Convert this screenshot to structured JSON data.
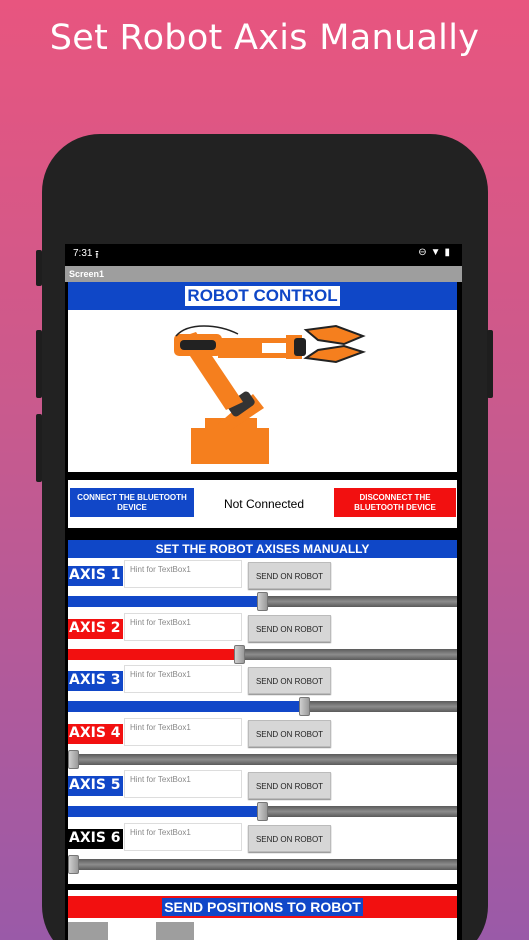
{
  "promo": {
    "title": "Set Robot Axis Manually"
  },
  "status_bar": {
    "time": "7:31",
    "upload_icon": "upload-arrow",
    "icons": [
      "do-not-disturb-icon",
      "wifi-icon",
      "battery-icon"
    ]
  },
  "app": {
    "screen_title": "Screen1",
    "header": "ROBOT CONTROL",
    "connect_button": "CONNECT THE BLUETOOTH DEVICE",
    "connection_status": "Not Connected",
    "disconnect_button": "DISCONNECT THE BLUETOOTH DEVICE",
    "axes_header": "SET THE ROBOT AXISES MANUALLY",
    "send_positions_header": "SEND POSITIONS TO ROBOT"
  },
  "axes": [
    {
      "label": "AXIS 1",
      "placeholder": "Hint for TextBox1",
      "button": "SEND ON ROBOT",
      "label_color": "#1147c8",
      "fill_color": "#1147c8",
      "value": 0.5
    },
    {
      "label": "AXIS 2",
      "placeholder": "Hint for TextBox1",
      "button": "SEND ON ROBOT",
      "label_color": "#f21010",
      "fill_color": "#f21010",
      "value": 0.44
    },
    {
      "label": "AXIS 3",
      "placeholder": "Hint for TextBox1",
      "button": "SEND ON ROBOT",
      "label_color": "#1147c8",
      "fill_color": "#1147c8",
      "value": 0.61
    },
    {
      "label": "AXIS 4",
      "placeholder": "Hint for TextBox1",
      "button": "SEND ON ROBOT",
      "label_color": "#f21010",
      "fill_color": "#f21010",
      "value": 0.0
    },
    {
      "label": "AXIS 5",
      "placeholder": "Hint for TextBox1",
      "button": "SEND ON ROBOT",
      "label_color": "#1147c8",
      "fill_color": "#1147c8",
      "value": 0.5
    },
    {
      "label": "AXIS 6",
      "placeholder": "Hint for TextBox1",
      "button": "SEND ON ROBOT",
      "label_color": "#000000",
      "fill_color": "#000000",
      "value": 0.0
    }
  ]
}
